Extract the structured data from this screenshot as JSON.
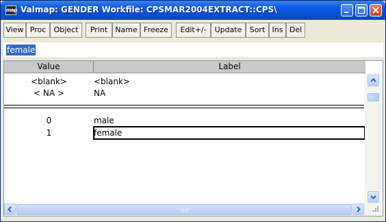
{
  "window": {
    "icon_text": "map",
    "title": "Valmap: GENDER   Workfile: CPSMAR2004EXTRACT::CPS\\"
  },
  "toolbar": {
    "buttons": [
      "View",
      "Proc",
      "Object",
      "Print",
      "Name",
      "Freeze",
      "Edit+/-",
      "Update",
      "Sort",
      "Ins",
      "Del"
    ]
  },
  "edit_field": {
    "value": "female"
  },
  "grid": {
    "headers": {
      "value": "Value",
      "label": "Label"
    },
    "special_rows": [
      {
        "value": "<blank>",
        "label": "<blank>"
      },
      {
        "value": "< NA >",
        "label": "NA"
      }
    ],
    "rows": [
      {
        "value": "0",
        "label": "male"
      },
      {
        "value": "1",
        "label": "female"
      }
    ]
  },
  "colors": {
    "titlebar": "#0a4fd2",
    "selection": "#316ac5",
    "header_bg": "#c9c9c9"
  }
}
